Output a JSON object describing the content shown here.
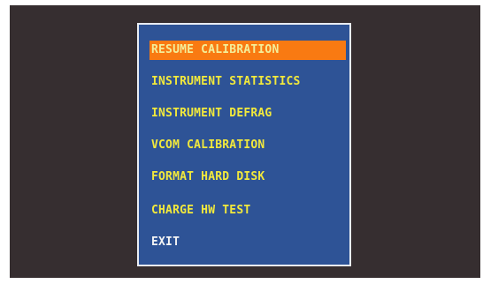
{
  "colors": {
    "screen_background": "#362e30",
    "panel_background": "#2e5396",
    "panel_border": "#e9edf3",
    "selection_highlight": "#f97a12",
    "item_text": "#f2e93c",
    "selected_text": "#f4ee98",
    "exit_text": "#f5f5f5"
  },
  "menu": {
    "selected_index": 0,
    "items": [
      {
        "label": "RESUME CALIBRATION"
      },
      {
        "label": "INSTRUMENT STATISTICS"
      },
      {
        "label": "INSTRUMENT DEFRAG"
      },
      {
        "label": "VCOM CALIBRATION"
      },
      {
        "label": "FORMAT HARD DISK"
      },
      {
        "label": "CHARGE HW TEST"
      },
      {
        "label": "EXIT"
      }
    ]
  }
}
